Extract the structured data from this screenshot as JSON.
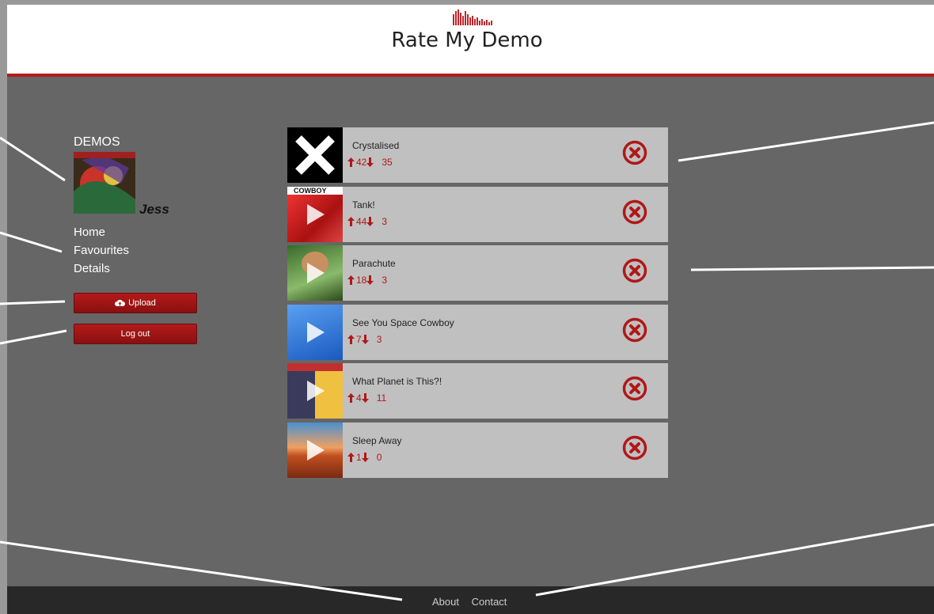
{
  "header": {
    "site_title": "Rate My Demo"
  },
  "sidebar": {
    "section_label": "DEMOS",
    "username": "Jess",
    "nav": [
      {
        "label": "Home"
      },
      {
        "label": "Favourites"
      },
      {
        "label": "Details"
      }
    ],
    "upload_label": "Upload",
    "logout_label": "Log out"
  },
  "demos": [
    {
      "title": "Crystalised",
      "up": "42",
      "down": "35",
      "thumb_color": "#000000",
      "has_play": false
    },
    {
      "title": "Tank!",
      "up": "44",
      "down": "3",
      "thumb_label": "COWBOY BEBOP",
      "thumb_color": "#c8282a",
      "has_play": true
    },
    {
      "title": "Parachute",
      "up": "18",
      "down": "3",
      "thumb_color": "#4a8a3a",
      "has_play": true
    },
    {
      "title": "See You Space Cowboy",
      "up": "7",
      "down": "3",
      "thumb_color": "#3a7ad0",
      "has_play": true
    },
    {
      "title": "What Planet is This?!",
      "up": "4",
      "down": "11",
      "thumb_color": "#e8c040",
      "has_play": true
    },
    {
      "title": "Sleep Away",
      "up": "1",
      "down": "0",
      "thumb_color": "#c06030",
      "has_play": true
    }
  ],
  "footer": {
    "about": "About",
    "contact": "Contact"
  },
  "colors": {
    "accent": "#b31b1b",
    "background": "#666666",
    "row_background": "#c0c0c0",
    "footer_background": "#282828"
  },
  "icons": [
    "logo-bars-icon",
    "upload-cloud-icon",
    "arrow-up-icon",
    "arrow-down-icon",
    "remove-circle-icon",
    "play-icon"
  ]
}
